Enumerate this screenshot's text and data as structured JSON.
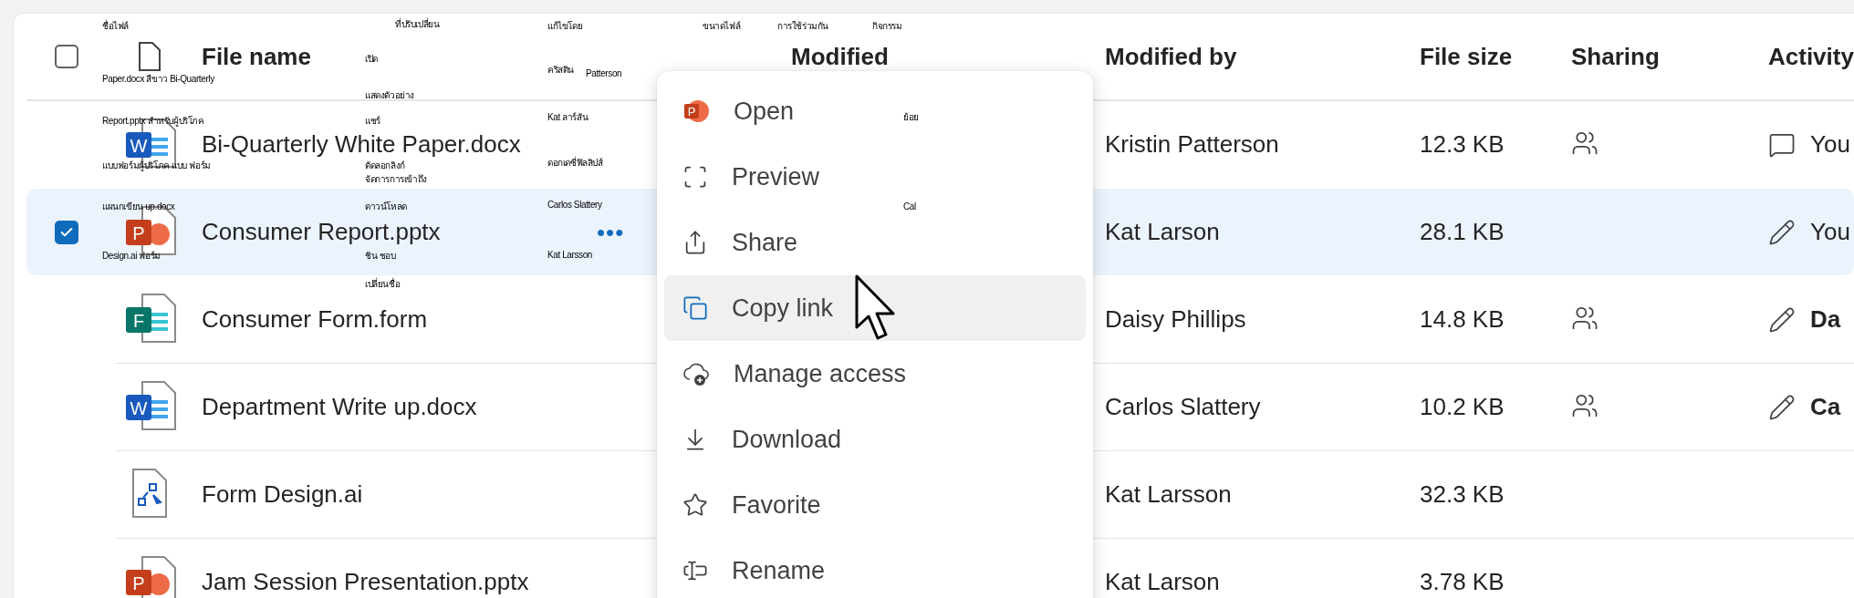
{
  "header": {
    "checked": false,
    "columns": [
      "File name",
      "Modified",
      "Modified by",
      "File size",
      "Sharing",
      "Activity"
    ]
  },
  "rows": [
    {
      "name": "Bi-Quarterly White Paper.docx",
      "kind": "word",
      "badge": "W",
      "modified_by": "Kristin Patterson",
      "size": "12.3 KB",
      "shared": true,
      "activity": {
        "kind": "comment",
        "text": "You"
      },
      "selected": false
    },
    {
      "name": "Consumer Report.pptx",
      "kind": "powerpoint",
      "badge": "P",
      "more": "•••",
      "modified_by": "Kat Larson",
      "size": "28.1 KB",
      "shared": false,
      "activity": {
        "kind": "edit",
        "text": "You"
      },
      "selected": true
    },
    {
      "name": "Consumer Form.form",
      "kind": "forms",
      "badge": "F",
      "modified_by": "Daisy Phillips",
      "size": "14.8 KB",
      "shared": true,
      "activity": {
        "kind": "edit",
        "text": "**Da**"
      },
      "selected": false
    },
    {
      "name": "Department Write up.docx",
      "kind": "word",
      "badge": "W",
      "modified_by": "Carlos Slattery",
      "size": "10.2 KB",
      "shared": true,
      "activity": {
        "kind": "edit",
        "text": "**Ca**"
      },
      "selected": false
    },
    {
      "name": "Form Design.ai",
      "kind": "diagram",
      "modified_by": "Kat Larsson",
      "size": "32.3 KB",
      "shared": false,
      "selected": false
    },
    {
      "name": "Jam Session Presentation.pptx",
      "kind": "powerpoint",
      "badge": "P",
      "modified_by": "Kat Larson",
      "size": "3.78 KB",
      "shared": false,
      "selected": false
    }
  ],
  "menu": {
    "items": [
      {
        "label": "Open",
        "kind": "powerpoint",
        "badge": "P",
        "highlighted": false
      },
      {
        "label": "Preview",
        "kind": "frame",
        "highlighted": false
      },
      {
        "label": "Share",
        "kind": "share",
        "highlighted": false
      },
      {
        "label": "Copy link",
        "kind": "copy",
        "highlighted": true
      },
      {
        "label": "Manage access",
        "kind": "cloud-add",
        "highlighted": false
      },
      {
        "label": "Download",
        "kind": "download",
        "highlighted": false
      },
      {
        "label": "Favorite",
        "kind": "star",
        "highlighted": false
      },
      {
        "label": "Rename",
        "kind": "rename",
        "highlighted": false
      }
    ]
  },
  "overlay_labels": [
    "ชื่อไฟล์",
    "ที่ปรับเปลี่ยน",
    "แก้ไขโดย",
    "ขนาดไฟล์",
    "การใช้ร่วมกัน",
    "กิจกรรม",
    "เปิด",
    "Paper.docx สีขาว Bi-Quarterly",
    "คริสติน",
    "Patterson",
    "แสดงตัวอย่าง",
    "Report.pptx สำหรับผู้บริโภค",
    "แชร์",
    "Kat ลาร์สัน",
    "ย้อย",
    "แบบฟอร์มผู้บริโภค แบบ ฟอร์ม",
    "ตัดลอกลิงก์",
    "ดอกเดซี่ฟิลลิปส์",
    "จัดการการเข้าถึง",
    "แผนกเขียน up.docx",
    "ดาวน์โหลด",
    "Carlos Slattery",
    "Cal",
    "Design.ai ฟอร์ม",
    "ชิน ชอบ",
    "Kat Larsson",
    "เปลี่ยนชื่อ"
  ]
}
